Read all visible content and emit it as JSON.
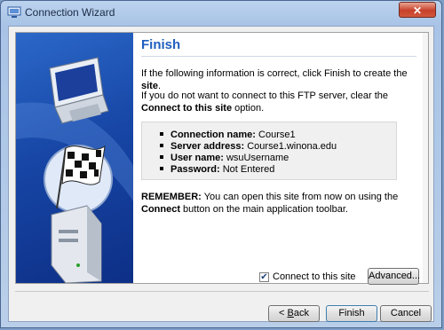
{
  "window": {
    "title": "Connection Wizard",
    "close_glyph": "✕"
  },
  "page": {
    "heading": "Finish",
    "p1_text": "If the following information is correct, click Finish to create the ",
    "p1_bold": "site",
    "p1_end": ".",
    "p2_text": "If you do not want to connect to this FTP server, clear the ",
    "p2_bold": "Connect to this site",
    "p2_end": " option.",
    "summary": [
      {
        "label": "Connection name:",
        "value": "Course1"
      },
      {
        "label": "Server address:",
        "value": "Course1.winona.edu"
      },
      {
        "label": "User name:",
        "value": "wsuUsername"
      },
      {
        "label": "Password:",
        "value": "Not Entered"
      }
    ],
    "p3_bold": "REMEMBER:",
    "p3_text": " You can open this site from now on using the ",
    "p3_bold2": "Connect",
    "p3_end": " button on the main application toolbar."
  },
  "options": {
    "connect_label": "Connect to this site",
    "connect_checked": true,
    "check_glyph": "✔"
  },
  "buttons": {
    "advanced": "Advanced...",
    "back_u": "B",
    "back_rest": "ack",
    "back_prefix": "< ",
    "finish": "Finish",
    "cancel": "Cancel"
  }
}
